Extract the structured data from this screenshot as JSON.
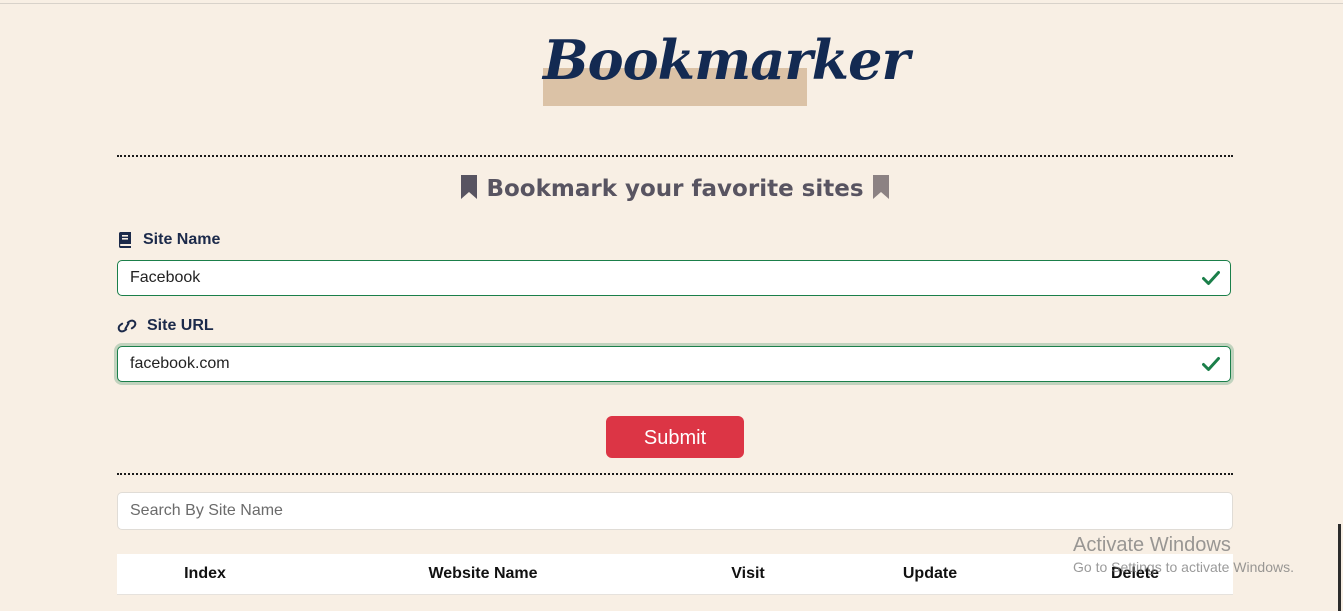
{
  "app": {
    "logo_text": "Bookmarker",
    "subtitle": "Bookmark your favorite sites"
  },
  "form": {
    "site_name": {
      "label": "Site Name",
      "value": "Facebook",
      "icon": "book-icon",
      "valid": true
    },
    "site_url": {
      "label": "Site URL",
      "value": "facebook.com",
      "icon": "link-icon",
      "valid": true
    },
    "submit_label": "Submit"
  },
  "search": {
    "placeholder": "Search By Site Name",
    "value": ""
  },
  "table": {
    "headers": [
      "Index",
      "Website Name",
      "Visit",
      "Update",
      "Delete"
    ],
    "rows": []
  },
  "watermark": {
    "line1": "Activate Windows",
    "line2": "Go to Settings to activate Windows."
  },
  "colors": {
    "background": "#f8efe4",
    "logo": "#132a52",
    "logo_band": "#dbc2a6",
    "valid": "#1b7f4a",
    "submit": "#dc3545"
  }
}
